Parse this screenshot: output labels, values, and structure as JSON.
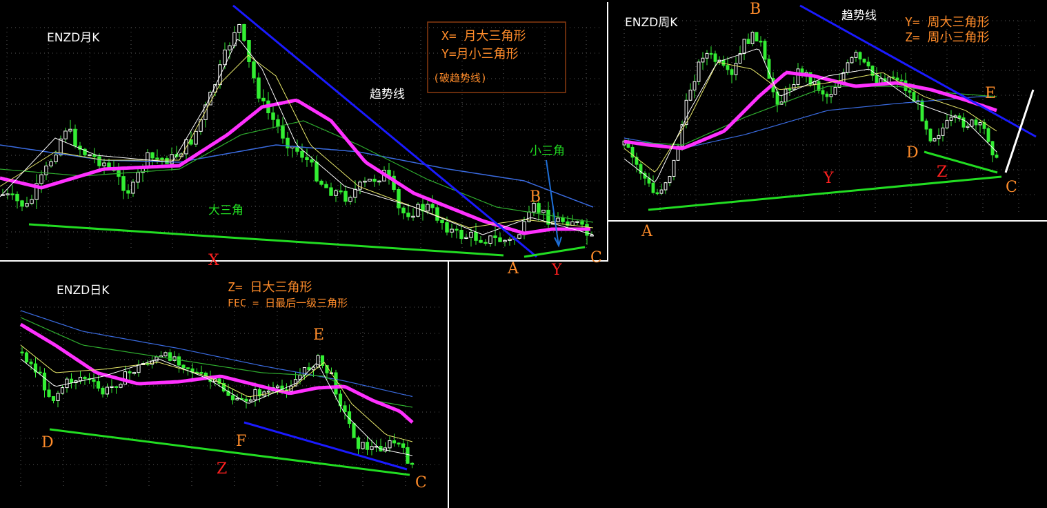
{
  "colors": {
    "background": "#000000",
    "ma_magenta": "#ff30ff",
    "trend_blue": "#1a1aff",
    "support_green": "#22dd22",
    "label_orange": "#ff8c2a",
    "label_red": "#ff2020"
  },
  "chart_data": [
    {
      "type": "candlestick",
      "title": "ENZD月K",
      "legend": [
        "X=  月大三角形",
        "Y=月小三角形",
        "(破趋势线)"
      ],
      "annotations": {
        "trend_line": "趋势线",
        "small_triangle": "小三角",
        "big_triangle": "大三角",
        "points": [
          "X",
          "A",
          "B",
          "Y",
          "C"
        ]
      }
    },
    {
      "type": "candlestick",
      "title": "ENZD周K",
      "legend": [
        "Y=  周大三角形",
        "Z=  周小三角形"
      ],
      "annotations": {
        "trend_line": "趋势线",
        "points": [
          "A",
          "B",
          "Y",
          "D",
          "Z",
          "E",
          "C"
        ]
      }
    },
    {
      "type": "candlestick",
      "title": "ENZD日K",
      "legend": [
        "Z=  日大三角形",
        "FEC  =  日最后一级三角形"
      ],
      "annotations": {
        "points": [
          "D",
          "F",
          "E",
          "Z",
          "C"
        ]
      }
    }
  ]
}
